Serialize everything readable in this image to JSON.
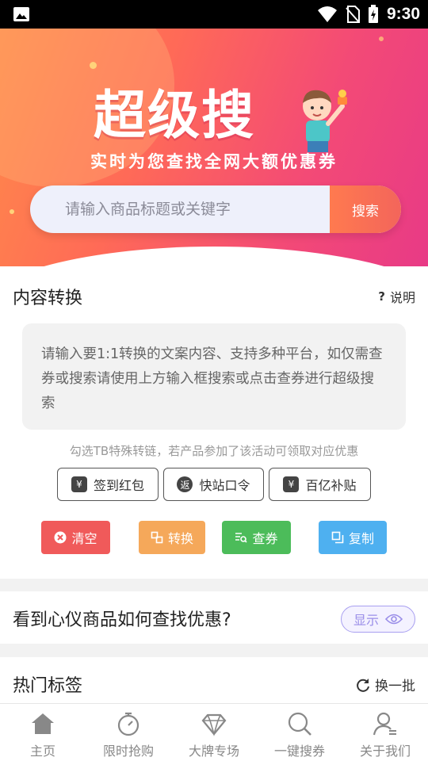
{
  "status_bar": {
    "time": "9:30"
  },
  "hero": {
    "title": "超级搜",
    "subtitle": "实时为您查找全网大额优惠券",
    "search_placeholder": "请输入商品标题或关键字",
    "search_button": "搜索"
  },
  "convert": {
    "title": "内容转换",
    "help_label": "说明",
    "textarea_placeholder": "请输入要1:1转换的文案内容、支持多种平台，如仅需查券或搜索请使用上方输入框搜索或点击查券进行超级搜索",
    "hint": "勾选TB特殊转链，若产品参加了该活动可领取对应优惠",
    "options": [
      {
        "label": "签到红包",
        "icon": "red-packet-icon"
      },
      {
        "label": "快站口令",
        "icon": "return-icon"
      },
      {
        "label": "百亿补贴",
        "icon": "subsidy-icon"
      }
    ],
    "actions": [
      {
        "label": "清空",
        "color": "#f05a5a",
        "icon": "close-circle-icon"
      },
      {
        "label": "转换",
        "color": "#f5a85a",
        "icon": "convert-icon"
      },
      {
        "label": "查券",
        "color": "#4cbc5a",
        "icon": "search-list-icon"
      },
      {
        "label": "复制",
        "color": "#4eb0f0",
        "icon": "copy-icon"
      }
    ]
  },
  "tip_card": {
    "title": "看到心仪商品如何查找优惠?",
    "show_label": "显示"
  },
  "hot_tags": {
    "title": "热门标签",
    "refresh_label": "换一批"
  },
  "tabbar": [
    {
      "label": "主页",
      "icon": "home-icon"
    },
    {
      "label": "限时抢购",
      "icon": "stopwatch-icon"
    },
    {
      "label": "大牌专场",
      "icon": "diamond-icon"
    },
    {
      "label": "一键搜券",
      "icon": "search-icon"
    },
    {
      "label": "关于我们",
      "icon": "user-icon"
    }
  ],
  "colors": {
    "accent": "#f34a76",
    "search_btn": "#f3655b",
    "tab_inactive": "#888888"
  }
}
